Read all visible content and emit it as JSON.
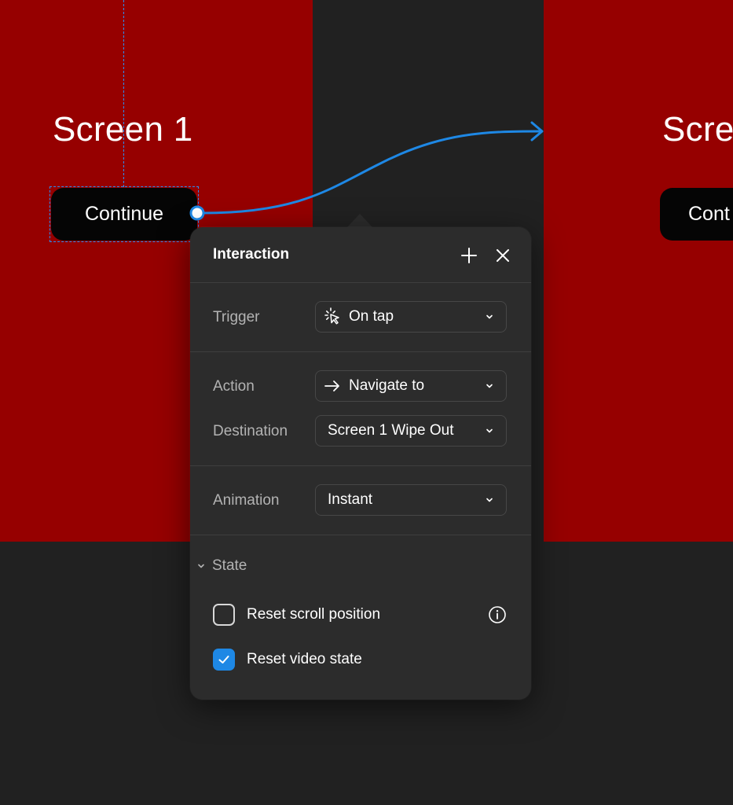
{
  "canvas": {
    "screens": [
      {
        "title": "Screen 1",
        "button_label": "Continue"
      },
      {
        "title": "Scre",
        "button_label": "Cont"
      }
    ]
  },
  "panel": {
    "title": "Interaction",
    "add_icon": "plus-icon",
    "close_icon": "close-icon",
    "trigger": {
      "label": "Trigger",
      "value": "On tap",
      "icon": "tap-icon"
    },
    "action": {
      "label": "Action",
      "value": "Navigate to",
      "icon": "arrow-right-icon"
    },
    "destination": {
      "label": "Destination",
      "value": "Screen 1 Wipe Out"
    },
    "animation": {
      "label": "Animation",
      "value": "Instant"
    },
    "state": {
      "label": "State",
      "options": [
        {
          "label": "Reset scroll position",
          "checked": false
        },
        {
          "label": "Reset video state",
          "checked": true
        }
      ]
    }
  },
  "colors": {
    "canvas_background": "#212121",
    "frame_red": "#960000",
    "accent_blue": "#1e88e5",
    "panel_background": "#2c2c2c"
  }
}
